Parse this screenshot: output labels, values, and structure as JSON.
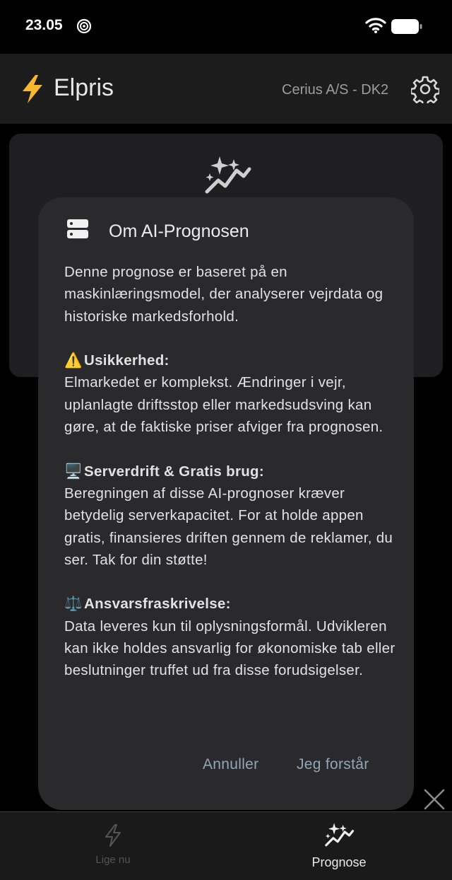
{
  "status_bar": {
    "time": "23.05"
  },
  "app_bar": {
    "title": "Elpris",
    "region": "Cerius A/S - DK2"
  },
  "dialog": {
    "title": "Om AI-Prognosen",
    "intro": "Denne prognose er baseret på en maskinlæringsmodel, der analyserer vejrdata og historiske markedsforhold.",
    "sections": [
      {
        "emoji": "⚠️",
        "heading": "Usikkerhed:",
        "text": "Elmarkedet er komplekst. Ændringer i vejr, uplanlagte driftsstop eller markedsudsving kan gøre, at de faktiske priser afviger fra prognosen."
      },
      {
        "emoji": "🖥️",
        "heading": "Serverdrift & Gratis brug:",
        "text": "Beregningen af disse AI-prognoser kræver betydelig serverkapacitet. For at holde appen gratis, finansieres driften gennem de reklamer, du ser. Tak for din støtte!"
      },
      {
        "emoji": "⚖️",
        "heading": "Ansvarsfraskrivelse:",
        "text": "Data leveres kun til oplysningsformål. Udvikleren kan ikke holdes ansvarlig for økonomiske tab eller beslutninger truffet ud fra disse forudsigelser."
      }
    ],
    "cancel_label": "Annuller",
    "confirm_label": "Jeg forstår"
  },
  "bottom_nav": {
    "items": [
      {
        "label": "Lige nu",
        "icon": "bolt-outline-icon",
        "active": false
      },
      {
        "label": "Prognose",
        "icon": "sparkle-trend-icon",
        "active": true
      }
    ]
  },
  "colors": {
    "background": "#000000",
    "app_bar": "#1c1c1c",
    "dialog": "#2a2a2d",
    "accent_bolt": "#f5b82e",
    "action_text": "#8fa7b8"
  }
}
